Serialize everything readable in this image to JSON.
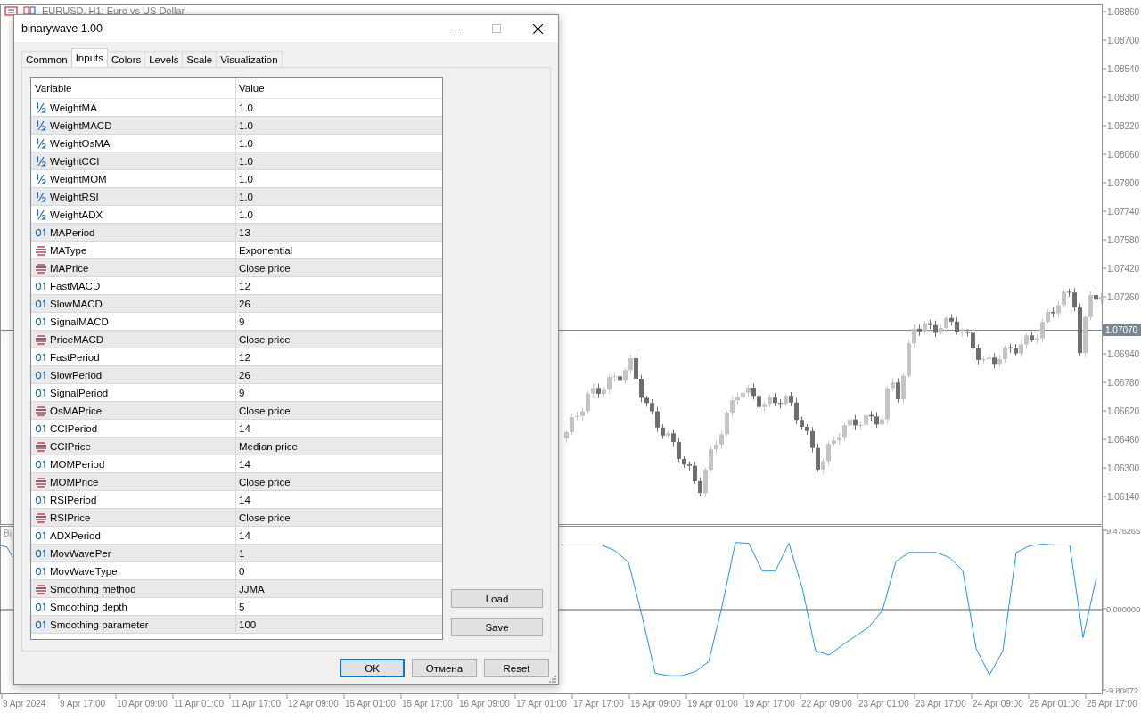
{
  "chart_window": {
    "title": "EURUSD, H1: Euro vs US Dollar",
    "price_axis_upper": [
      "1.08860",
      "1.08700",
      "1.08540",
      "1.08380",
      "1.08220",
      "1.08060",
      "1.07900",
      "1.07740",
      "1.07580",
      "1.07420",
      "1.07260"
    ],
    "price_axis_lower": [
      "1.06940",
      "1.06780",
      "1.06620",
      "1.06460",
      "1.06300",
      "1.06140"
    ],
    "current_price": "1.07070",
    "indicator_label": "Bi",
    "indicator_chart": {
      "chart_data": {
        "type": "line",
        "ylim": [
          -9.80672,
          9.476265
        ],
        "yticks": [
          {
            "value": 9.476265,
            "label": "9.476265"
          },
          {
            "value": 0,
            "label": "0.000000"
          },
          {
            "value": -9.80672,
            "label": "-9.80672"
          }
        ],
        "series": [
          {
            "color": "#1e90ff",
            "values": [
              7.7,
              7.7,
              7.7,
              7.7,
              7.0,
              5.6,
              -0.8,
              -7.8,
              -8.1,
              -8.1,
              -7.6,
              -6.4,
              0.3,
              8.0,
              7.9,
              4.6,
              4.6,
              7.9,
              2.5,
              -5.1,
              -5.6,
              -4.4,
              -3.3,
              -2.2,
              -0.2,
              5.7,
              6.8,
              6.8,
              6.8,
              6.2,
              4.6,
              -4.8,
              -8.0,
              -5.1,
              6.8,
              7.6,
              7.8,
              7.7,
              7.7,
              -3.5,
              3.8
            ]
          }
        ]
      }
    },
    "time_axis": [
      "9 Apr 2024",
      "9 Apr 17:00",
      "10 Apr 09:00",
      "11 Apr 01:00",
      "11 Apr 17:00",
      "12 Apr 09:00",
      "15 Apr 01:00",
      "15 Apr 17:00",
      "16 Apr 09:00",
      "17 Apr 01:00",
      "17 Apr 17:00",
      "18 Apr 09:00",
      "19 Apr 01:00",
      "19 Apr 17:00",
      "22 Apr 09:00",
      "23 Apr 01:00",
      "23 Apr 17:00",
      "24 Apr 09:00",
      "25 Apr 01:00",
      "25 Apr 17:00"
    ]
  },
  "dialog": {
    "title": "binarywave 1.00",
    "tabs": [
      {
        "label": "Common",
        "selected": false
      },
      {
        "label": "Inputs",
        "selected": true
      },
      {
        "label": "Colors",
        "selected": false
      },
      {
        "label": "Levels",
        "selected": false
      },
      {
        "label": "Scale",
        "selected": false
      },
      {
        "label": "Visualization",
        "selected": false
      }
    ],
    "columns": [
      "Variable",
      "Value"
    ],
    "rows": [
      {
        "kind": "double",
        "variable": "WeightMA",
        "value": "1.0"
      },
      {
        "kind": "double",
        "variable": "WeightMACD",
        "value": "1.0"
      },
      {
        "kind": "double",
        "variable": "WeightOsMA",
        "value": "1.0"
      },
      {
        "kind": "double",
        "variable": "WeightCCI",
        "value": "1.0"
      },
      {
        "kind": "double",
        "variable": "WeightMOM",
        "value": "1.0"
      },
      {
        "kind": "double",
        "variable": "WeightRSI",
        "value": "1.0"
      },
      {
        "kind": "double",
        "variable": "WeightADX",
        "value": "1.0"
      },
      {
        "kind": "int",
        "variable": "MAPeriod",
        "value": "13"
      },
      {
        "kind": "enum",
        "variable": "MAType",
        "value": "Exponential"
      },
      {
        "kind": "enum",
        "variable": "MAPrice",
        "value": "Close price"
      },
      {
        "kind": "int",
        "variable": "FastMACD",
        "value": "12"
      },
      {
        "kind": "int",
        "variable": "SlowMACD",
        "value": "26"
      },
      {
        "kind": "int",
        "variable": "SignalMACD",
        "value": "9"
      },
      {
        "kind": "enum",
        "variable": "PriceMACD",
        "value": "Close price"
      },
      {
        "kind": "int",
        "variable": "FastPeriod",
        "value": "12"
      },
      {
        "kind": "int",
        "variable": "SlowPeriod",
        "value": "26"
      },
      {
        "kind": "int",
        "variable": "SignalPeriod",
        "value": "9"
      },
      {
        "kind": "enum",
        "variable": "OsMAPrice",
        "value": "Close price"
      },
      {
        "kind": "int",
        "variable": "CCIPeriod",
        "value": "14"
      },
      {
        "kind": "enum",
        "variable": "CCIPrice",
        "value": "Median price"
      },
      {
        "kind": "int",
        "variable": "MOMPeriod",
        "value": "14"
      },
      {
        "kind": "enum",
        "variable": "MOMPrice",
        "value": "Close price"
      },
      {
        "kind": "int",
        "variable": "RSIPeriod",
        "value": "14"
      },
      {
        "kind": "enum",
        "variable": "RSIPrice",
        "value": "Close price"
      },
      {
        "kind": "int",
        "variable": "ADXPeriod",
        "value": "14"
      },
      {
        "kind": "int",
        "variable": "MovWavePer",
        "value": "1"
      },
      {
        "kind": "int",
        "variable": "MovWaveType",
        "value": "0"
      },
      {
        "kind": "enum",
        "variable": "Smoothing method",
        "value": "JJMA"
      },
      {
        "kind": "int",
        "variable": "Smoothing depth",
        "value": "5"
      },
      {
        "kind": "int",
        "variable": "Smoothing parameter",
        "value": "100"
      }
    ],
    "side_buttons": [
      "Load",
      "Save"
    ],
    "buttons": [
      {
        "label": "OK",
        "default": true
      },
      {
        "label": "Отмена",
        "default": false
      },
      {
        "label": "Reset",
        "default": false
      }
    ]
  }
}
